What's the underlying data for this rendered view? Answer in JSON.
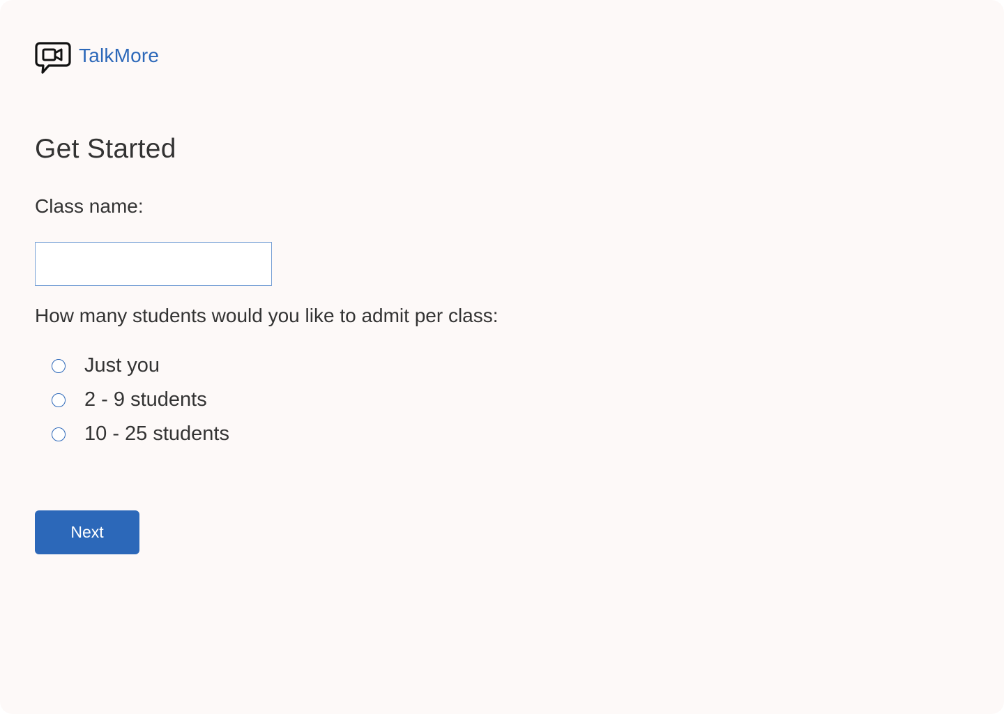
{
  "brand": {
    "name": "TalkMore",
    "icon": "video-chat-bubble-icon",
    "color": "#2c68b9"
  },
  "form": {
    "title": "Get Started",
    "class_name_label": "Class name:",
    "class_name_value": "",
    "class_name_placeholder": "",
    "question": "How many students would you like to admit per class:",
    "options": [
      {
        "label": "Just you",
        "selected": false
      },
      {
        "label": "2 - 9 students",
        "selected": false
      },
      {
        "label": "10 - 25 students",
        "selected": false
      }
    ],
    "next_label": "Next"
  },
  "colors": {
    "background": "#fdf9f8",
    "accent": "#2c68b9",
    "text": "#333333"
  }
}
